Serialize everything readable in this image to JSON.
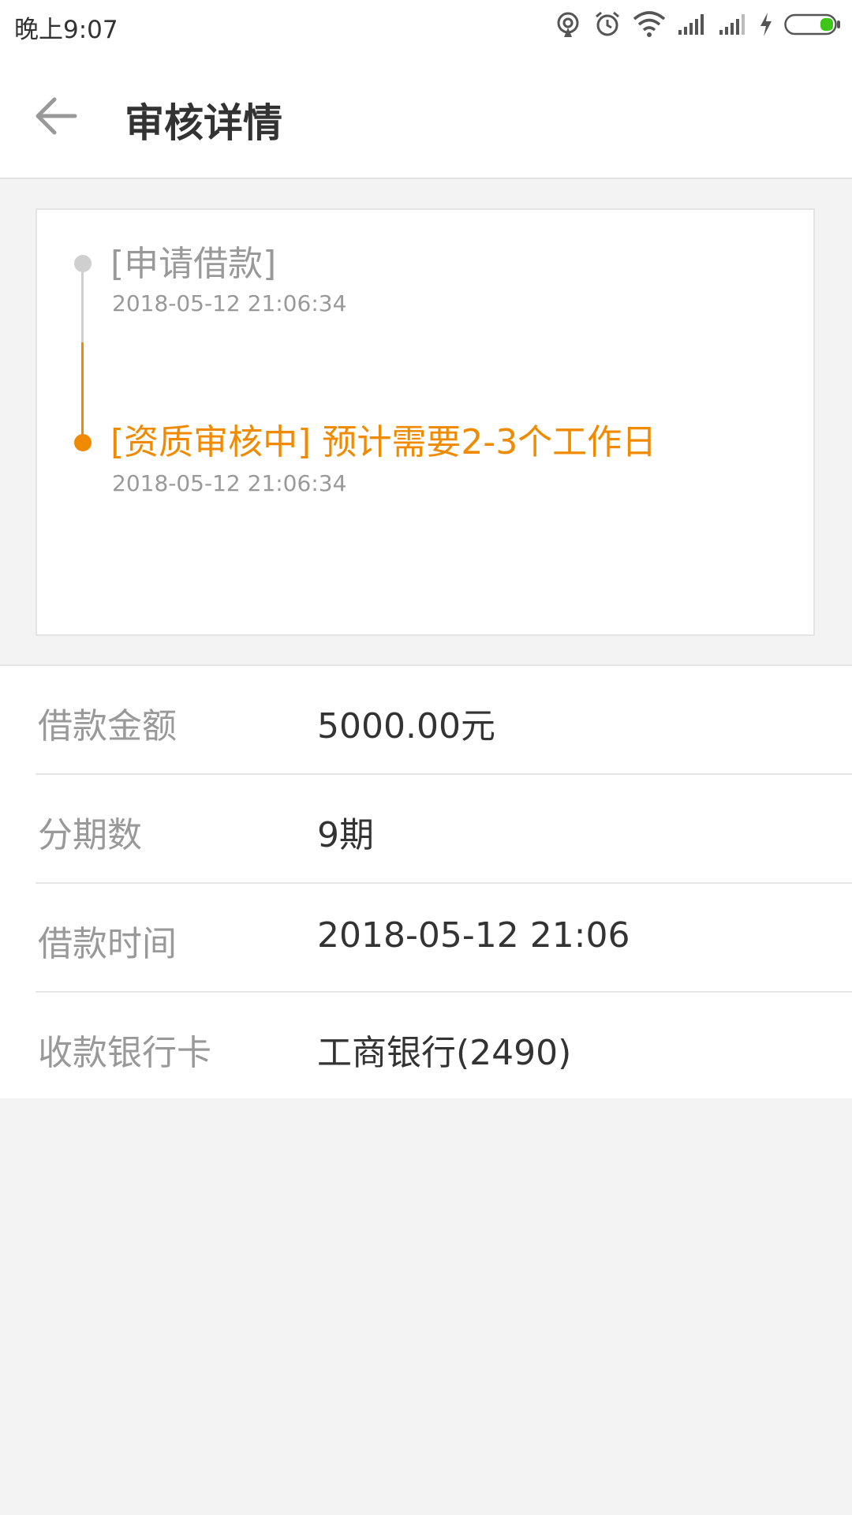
{
  "status_bar": {
    "time": "晚上9:07"
  },
  "header": {
    "title": "审核详情"
  },
  "timeline": [
    {
      "title": "[申请借款]",
      "time": "2018-05-12 21:06:34",
      "state": "done"
    },
    {
      "title": "[资质审核中] 预计需要2-3个工作日",
      "time": "2018-05-12 21:06:34",
      "state": "current"
    }
  ],
  "details": {
    "rows": [
      {
        "label": "借款金额",
        "value": "5000.00元"
      },
      {
        "label": "分期数",
        "value": "9期"
      },
      {
        "label": "借款时间",
        "value": "2018-05-12 21:06"
      },
      {
        "label": "收款银行卡",
        "value": "工商银行(2490)"
      }
    ]
  },
  "colors": {
    "accent": "#f08a00",
    "muted": "#999999",
    "text": "#333333",
    "background": "#f3f3f3",
    "battery": "#3fc41a"
  }
}
